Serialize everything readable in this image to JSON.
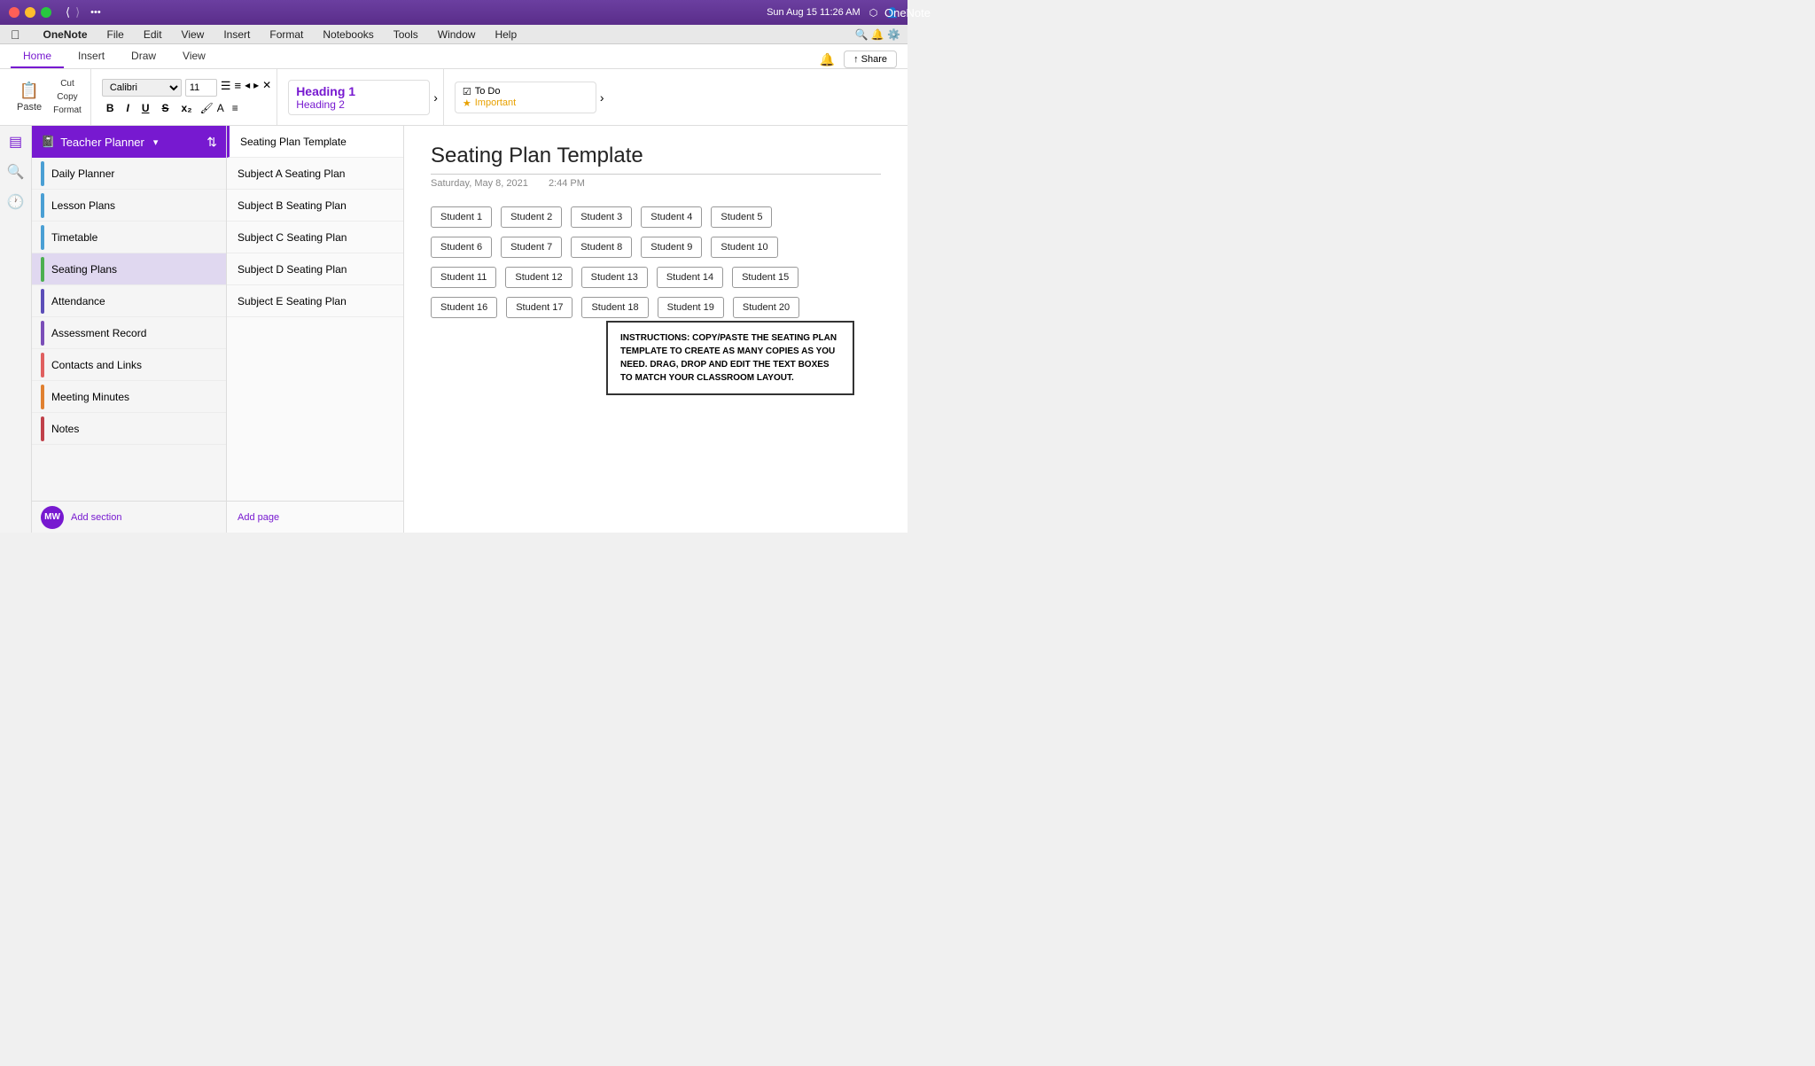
{
  "titlebar": {
    "title": "OneNote",
    "time": "Sun Aug 15  11:26 AM"
  },
  "menubar": {
    "items": [
      "🍎",
      "OneNote",
      "File",
      "Edit",
      "View",
      "Insert",
      "Format",
      "Notebooks",
      "Tools",
      "Window",
      "Help"
    ]
  },
  "ribbon": {
    "tabs": [
      "Home",
      "Insert",
      "Draw",
      "View"
    ],
    "active_tab": "Home",
    "share_label": "↑ Share",
    "paste_label": "Paste",
    "cut_label": "Cut",
    "copy_label": "Copy",
    "format_label": "Format",
    "font": "Calibri",
    "font_size": "11",
    "styles": {
      "heading1": "Heading 1",
      "heading2": "Heading 2"
    },
    "tags": {
      "todo": "To Do",
      "important": "Important"
    }
  },
  "notebook": {
    "name": "Teacher Planner",
    "sections": [
      {
        "label": "Daily Planner",
        "color": "#4a9fd4"
      },
      {
        "label": "Lesson Plans",
        "color": "#4a9fd4"
      },
      {
        "label": "Timetable",
        "color": "#4a9fd4"
      },
      {
        "label": "Seating Plans",
        "color": "#4caf50",
        "active": true
      },
      {
        "label": "Attendance",
        "color": "#5c4eb8"
      },
      {
        "label": "Assessment Record",
        "color": "#7b4eb8"
      },
      {
        "label": "Contacts and Links",
        "color": "#e06060"
      },
      {
        "label": "Meeting Minutes",
        "color": "#e08030"
      },
      {
        "label": "Notes",
        "color": "#c0404a"
      }
    ],
    "add_section": "Add section"
  },
  "pages": {
    "items": [
      {
        "label": "Seating Plan Template",
        "active": true
      },
      {
        "label": "Subject A Seating Plan"
      },
      {
        "label": "Subject B Seating Plan"
      },
      {
        "label": "Subject C Seating Plan"
      },
      {
        "label": "Subject D Seating Plan"
      },
      {
        "label": "Subject E Seating Plan"
      }
    ],
    "add_page": "Add page"
  },
  "content": {
    "title": "Seating Plan Template",
    "date": "Saturday, May 8, 2021",
    "time": "2:44 PM",
    "students": [
      [
        "Student 1",
        "Student 2",
        "Student 3",
        "Student 4",
        "Student 5"
      ],
      [
        "Student 6",
        "Student 7",
        "Student 8",
        "Student 9",
        "Student 10"
      ],
      [
        "Student 11",
        "Student 12",
        "Student 13",
        "Student 14",
        "Student 15"
      ],
      [
        "Student 16",
        "Student 17",
        "Student 18",
        "Student 19",
        "Student 20"
      ]
    ],
    "instructions": "INSTRUCTIONS: COPY/PASTE THE SEATING PLAN TEMPLATE TO CREATE AS MANY COPIES AS YOU NEED. DRAG, DROP AND EDIT THE TEXT BOXES TO MATCH YOUR CLASSROOM LAYOUT."
  }
}
